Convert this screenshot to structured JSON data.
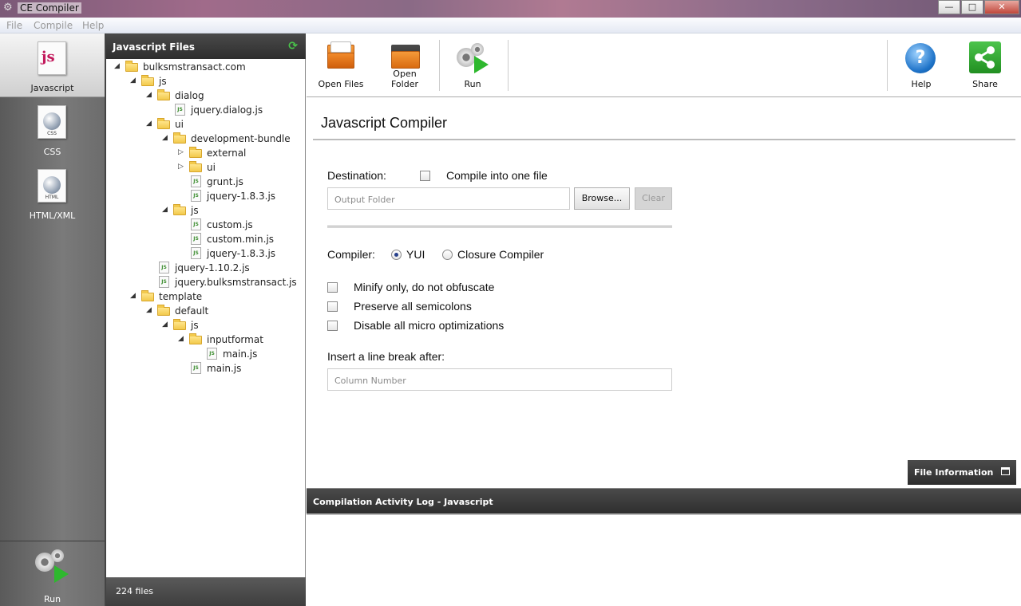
{
  "window": {
    "title": "CE Compiler",
    "minimize": "—",
    "maximize": "□",
    "close": "✕"
  },
  "menu": [
    "File",
    "Compile",
    "Help"
  ],
  "nav": {
    "items": [
      {
        "label": "Javascript",
        "icon": "js-file-icon",
        "active": true
      },
      {
        "label": "CSS",
        "icon": "css-file-icon",
        "cap": "CSS"
      },
      {
        "label": "HTML/XML",
        "icon": "html-file-icon",
        "cap": "HTML"
      }
    ],
    "run_label": "Run"
  },
  "files_panel": {
    "title": "Javascript Files",
    "count": "224 files",
    "tree": [
      {
        "label": "bulksmstransact.com",
        "type": "folder",
        "depth": 0,
        "expanded": true
      },
      {
        "label": "js",
        "type": "folder",
        "depth": 1,
        "expanded": true
      },
      {
        "label": "dialog",
        "type": "folder",
        "depth": 2,
        "expanded": true
      },
      {
        "label": "jquery.dialog.js",
        "type": "file",
        "depth": 3
      },
      {
        "label": "ui",
        "type": "folder",
        "depth": 2,
        "expanded": true
      },
      {
        "label": "development-bundle",
        "type": "folder",
        "depth": 3,
        "expanded": true
      },
      {
        "label": "external",
        "type": "folder",
        "depth": 4,
        "expanded": false
      },
      {
        "label": "ui",
        "type": "folder",
        "depth": 4,
        "expanded": false
      },
      {
        "label": "grunt.js",
        "type": "file",
        "depth": 4
      },
      {
        "label": "jquery-1.8.3.js",
        "type": "file",
        "depth": 4
      },
      {
        "label": "js",
        "type": "folder",
        "depth": 3,
        "expanded": true
      },
      {
        "label": "custom.js",
        "type": "file",
        "depth": 4
      },
      {
        "label": "custom.min.js",
        "type": "file",
        "depth": 4
      },
      {
        "label": "jquery-1.8.3.js",
        "type": "file",
        "depth": 4
      },
      {
        "label": "jquery-1.10.2.js",
        "type": "file",
        "depth": 2
      },
      {
        "label": "jquery.bulksmstransact.js",
        "type": "file",
        "depth": 2
      },
      {
        "label": "template",
        "type": "folder",
        "depth": 1,
        "expanded": true
      },
      {
        "label": "default",
        "type": "folder",
        "depth": 2,
        "expanded": true
      },
      {
        "label": "js",
        "type": "folder",
        "depth": 3,
        "expanded": true
      },
      {
        "label": "inputformat",
        "type": "folder",
        "depth": 4,
        "expanded": true
      },
      {
        "label": "main.js",
        "type": "file",
        "depth": 5
      },
      {
        "label": "main.js",
        "type": "file",
        "depth": 4
      }
    ]
  },
  "toolbar": {
    "open_files": "Open Files",
    "open_folder": "Open Folder",
    "run": "Run",
    "help": "Help",
    "share": "Share"
  },
  "compiler": {
    "title": "Javascript Compiler",
    "destination_label": "Destination:",
    "compile_one_label": "Compile into one file",
    "compile_one_checked": false,
    "output_placeholder": "Output Folder",
    "browse_label": "Browse...",
    "clear_label": "Clear",
    "compiler_label": "Compiler:",
    "opt_yui": "YUI",
    "opt_closure": "Closure Compiler",
    "selected": "YUI",
    "options": [
      {
        "label": "Minify only, do not obfuscate",
        "checked": false
      },
      {
        "label": "Preserve all semicolons",
        "checked": false
      },
      {
        "label": "Disable all micro optimizations",
        "checked": false
      }
    ],
    "linebreak_label": "Insert a line break after:",
    "column_placeholder": "Column Number"
  },
  "file_information": "File Information",
  "log": {
    "title": "Compilation Activity Log - Javascript"
  }
}
